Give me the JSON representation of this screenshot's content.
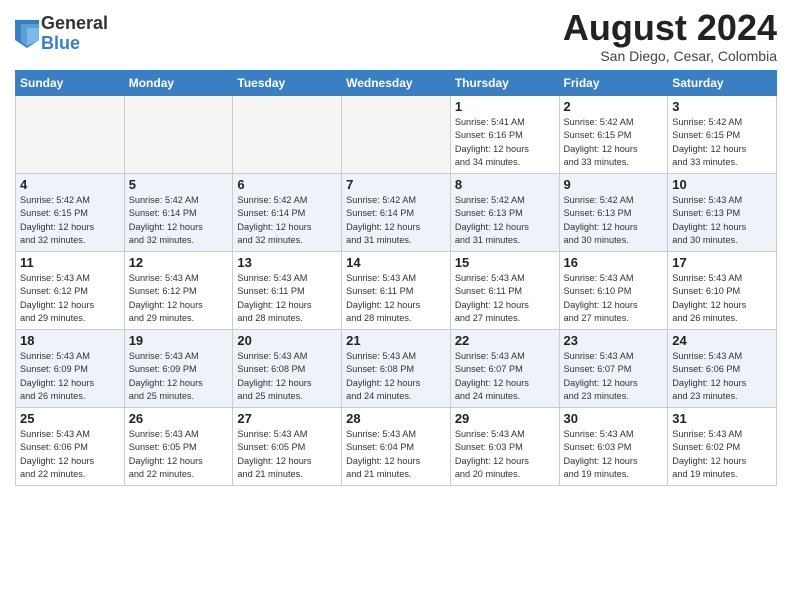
{
  "header": {
    "logo_general": "General",
    "logo_blue": "Blue",
    "month_title": "August 2024",
    "location": "San Diego, Cesar, Colombia"
  },
  "days_of_week": [
    "Sunday",
    "Monday",
    "Tuesday",
    "Wednesday",
    "Thursday",
    "Friday",
    "Saturday"
  ],
  "weeks": [
    [
      {
        "num": "",
        "info": "",
        "empty": true
      },
      {
        "num": "",
        "info": "",
        "empty": true
      },
      {
        "num": "",
        "info": "",
        "empty": true
      },
      {
        "num": "",
        "info": "",
        "empty": true
      },
      {
        "num": "1",
        "info": "Sunrise: 5:41 AM\nSunset: 6:16 PM\nDaylight: 12 hours\nand 34 minutes."
      },
      {
        "num": "2",
        "info": "Sunrise: 5:42 AM\nSunset: 6:15 PM\nDaylight: 12 hours\nand 33 minutes."
      },
      {
        "num": "3",
        "info": "Sunrise: 5:42 AM\nSunset: 6:15 PM\nDaylight: 12 hours\nand 33 minutes."
      }
    ],
    [
      {
        "num": "4",
        "info": "Sunrise: 5:42 AM\nSunset: 6:15 PM\nDaylight: 12 hours\nand 32 minutes."
      },
      {
        "num": "5",
        "info": "Sunrise: 5:42 AM\nSunset: 6:14 PM\nDaylight: 12 hours\nand 32 minutes."
      },
      {
        "num": "6",
        "info": "Sunrise: 5:42 AM\nSunset: 6:14 PM\nDaylight: 12 hours\nand 32 minutes."
      },
      {
        "num": "7",
        "info": "Sunrise: 5:42 AM\nSunset: 6:14 PM\nDaylight: 12 hours\nand 31 minutes."
      },
      {
        "num": "8",
        "info": "Sunrise: 5:42 AM\nSunset: 6:13 PM\nDaylight: 12 hours\nand 31 minutes."
      },
      {
        "num": "9",
        "info": "Sunrise: 5:42 AM\nSunset: 6:13 PM\nDaylight: 12 hours\nand 30 minutes."
      },
      {
        "num": "10",
        "info": "Sunrise: 5:43 AM\nSunset: 6:13 PM\nDaylight: 12 hours\nand 30 minutes."
      }
    ],
    [
      {
        "num": "11",
        "info": "Sunrise: 5:43 AM\nSunset: 6:12 PM\nDaylight: 12 hours\nand 29 minutes."
      },
      {
        "num": "12",
        "info": "Sunrise: 5:43 AM\nSunset: 6:12 PM\nDaylight: 12 hours\nand 29 minutes."
      },
      {
        "num": "13",
        "info": "Sunrise: 5:43 AM\nSunset: 6:11 PM\nDaylight: 12 hours\nand 28 minutes."
      },
      {
        "num": "14",
        "info": "Sunrise: 5:43 AM\nSunset: 6:11 PM\nDaylight: 12 hours\nand 28 minutes."
      },
      {
        "num": "15",
        "info": "Sunrise: 5:43 AM\nSunset: 6:11 PM\nDaylight: 12 hours\nand 27 minutes."
      },
      {
        "num": "16",
        "info": "Sunrise: 5:43 AM\nSunset: 6:10 PM\nDaylight: 12 hours\nand 27 minutes."
      },
      {
        "num": "17",
        "info": "Sunrise: 5:43 AM\nSunset: 6:10 PM\nDaylight: 12 hours\nand 26 minutes."
      }
    ],
    [
      {
        "num": "18",
        "info": "Sunrise: 5:43 AM\nSunset: 6:09 PM\nDaylight: 12 hours\nand 26 minutes."
      },
      {
        "num": "19",
        "info": "Sunrise: 5:43 AM\nSunset: 6:09 PM\nDaylight: 12 hours\nand 25 minutes."
      },
      {
        "num": "20",
        "info": "Sunrise: 5:43 AM\nSunset: 6:08 PM\nDaylight: 12 hours\nand 25 minutes."
      },
      {
        "num": "21",
        "info": "Sunrise: 5:43 AM\nSunset: 6:08 PM\nDaylight: 12 hours\nand 24 minutes."
      },
      {
        "num": "22",
        "info": "Sunrise: 5:43 AM\nSunset: 6:07 PM\nDaylight: 12 hours\nand 24 minutes."
      },
      {
        "num": "23",
        "info": "Sunrise: 5:43 AM\nSunset: 6:07 PM\nDaylight: 12 hours\nand 23 minutes."
      },
      {
        "num": "24",
        "info": "Sunrise: 5:43 AM\nSunset: 6:06 PM\nDaylight: 12 hours\nand 23 minutes."
      }
    ],
    [
      {
        "num": "25",
        "info": "Sunrise: 5:43 AM\nSunset: 6:06 PM\nDaylight: 12 hours\nand 22 minutes."
      },
      {
        "num": "26",
        "info": "Sunrise: 5:43 AM\nSunset: 6:05 PM\nDaylight: 12 hours\nand 22 minutes."
      },
      {
        "num": "27",
        "info": "Sunrise: 5:43 AM\nSunset: 6:05 PM\nDaylight: 12 hours\nand 21 minutes."
      },
      {
        "num": "28",
        "info": "Sunrise: 5:43 AM\nSunset: 6:04 PM\nDaylight: 12 hours\nand 21 minutes."
      },
      {
        "num": "29",
        "info": "Sunrise: 5:43 AM\nSunset: 6:03 PM\nDaylight: 12 hours\nand 20 minutes."
      },
      {
        "num": "30",
        "info": "Sunrise: 5:43 AM\nSunset: 6:03 PM\nDaylight: 12 hours\nand 19 minutes."
      },
      {
        "num": "31",
        "info": "Sunrise: 5:43 AM\nSunset: 6:02 PM\nDaylight: 12 hours\nand 19 minutes."
      }
    ]
  ]
}
